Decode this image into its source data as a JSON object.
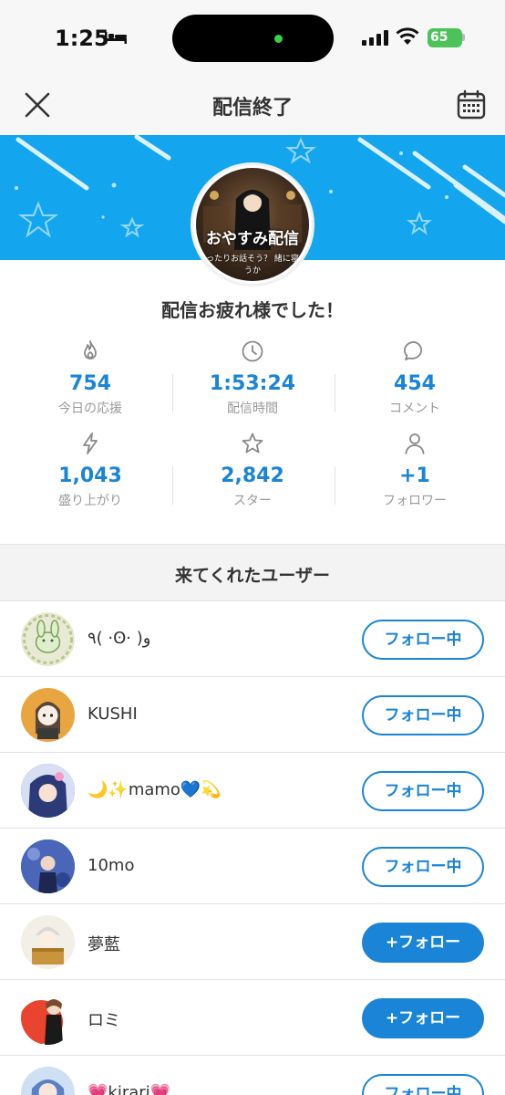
{
  "status_bar": {
    "time": "1:25",
    "battery": "65"
  },
  "header": {
    "title": "配信終了"
  },
  "stream": {
    "avatar_text": "おやすみ配信",
    "avatar_subtext": "ゆったりお話そう？ 緒に寝ようか"
  },
  "greeting": "配信お疲れ様でした！",
  "stats": [
    {
      "icon": "flame-icon",
      "value": "754",
      "label": "今日の応援"
    },
    {
      "icon": "clock-icon",
      "value": "1:53:24",
      "label": "配信時間"
    },
    {
      "icon": "comment-icon",
      "value": "454",
      "label": "コメント"
    },
    {
      "icon": "lightning-icon",
      "value": "1,043",
      "label": "盛り上がり"
    },
    {
      "icon": "star-icon",
      "value": "2,842",
      "label": "スター"
    },
    {
      "icon": "person-icon",
      "value": "+1",
      "label": "フォロワー"
    }
  ],
  "section": {
    "title": "来てくれたユーザー"
  },
  "users": [
    {
      "name": "٩( ·ʘ· )و",
      "button": "フォロー中",
      "following": true,
      "avatar_color": "#e8ead6"
    },
    {
      "name": "KUSHI",
      "button": "フォロー中",
      "following": true,
      "avatar_color": "#e9a640"
    },
    {
      "name": "🌙✨mamo💙💫",
      "button": "フォロー中",
      "following": true,
      "avatar_color": "#5f6fb4"
    },
    {
      "name": "10mo",
      "button": "フォロー中",
      "following": true,
      "avatar_color": "#3f5fb0"
    },
    {
      "name": "夢藍",
      "button": "+フォロー",
      "following": false,
      "avatar_color": "#f1efe6"
    },
    {
      "name": "ロミ",
      "button": "+フォロー",
      "following": false,
      "avatar_color": "#e8442f"
    },
    {
      "name": "💗kirari💗",
      "button": "フォロー中",
      "following": true,
      "avatar_color": "#cfe0f4"
    }
  ],
  "colors": {
    "accent": "#1a84d6",
    "banner": "#13a6ee"
  }
}
